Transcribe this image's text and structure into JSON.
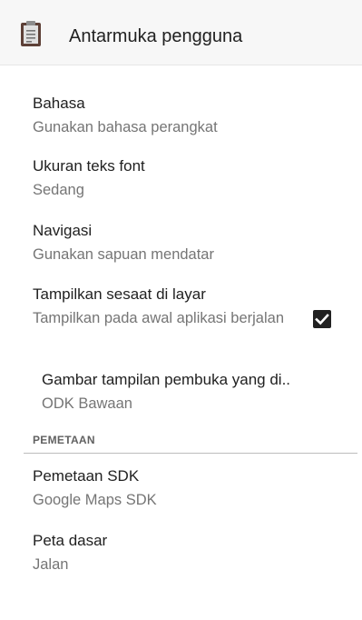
{
  "app_bar": {
    "title": "Antarmuka pengguna",
    "icon": "clipboard-icon"
  },
  "prefs": [
    {
      "title": "Bahasa",
      "summary": "Gunakan bahasa perangkat"
    },
    {
      "title": "Ukuran teks font",
      "summary": "Sedang"
    },
    {
      "title": "Navigasi",
      "summary": "Gunakan sapuan mendatar"
    },
    {
      "title": "Tampilkan sesaat di layar",
      "summary": "Tampilkan pada awal aplikasi berjalan",
      "checked": true
    },
    {
      "title": "Gambar tampilan pembuka yang di..",
      "summary": "ODK Bawaan"
    }
  ],
  "section_mapping": {
    "header": "PEMETAAN",
    "prefs": [
      {
        "title": "Pemetaan SDK",
        "summary": "Google Maps SDK"
      },
      {
        "title": "Peta dasar",
        "summary": "Jalan"
      }
    ]
  },
  "colors": {
    "title_text": "#212121",
    "summary_text": "#757575",
    "app_bar_bg": "#f7f7f7",
    "checkbox": "#212121"
  }
}
